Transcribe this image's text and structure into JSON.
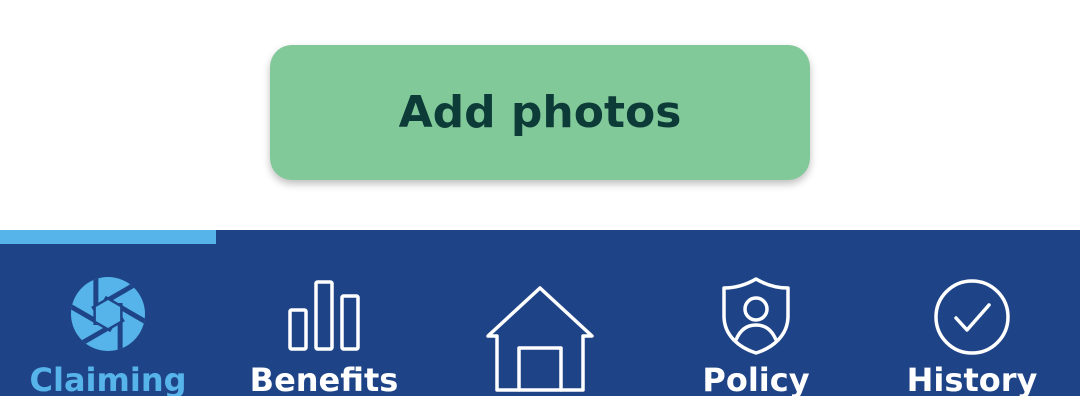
{
  "colors": {
    "button_bg": "#82c99a",
    "button_text": "#0d3b38",
    "nav_bg": "#1e4487",
    "nav_active": "#56b4eb",
    "nav_inactive": "#ffffff"
  },
  "actions": {
    "add_photos_label": "Add photos"
  },
  "nav": {
    "active_index": 0,
    "items": [
      {
        "label": "Claiming",
        "icon": "camera-aperture-icon"
      },
      {
        "label": "Benefits",
        "icon": "bar-chart-icon"
      },
      {
        "label": "",
        "icon": "home-icon"
      },
      {
        "label": "Policy",
        "icon": "shield-user-icon"
      },
      {
        "label": "History",
        "icon": "check-circle-icon"
      }
    ]
  }
}
